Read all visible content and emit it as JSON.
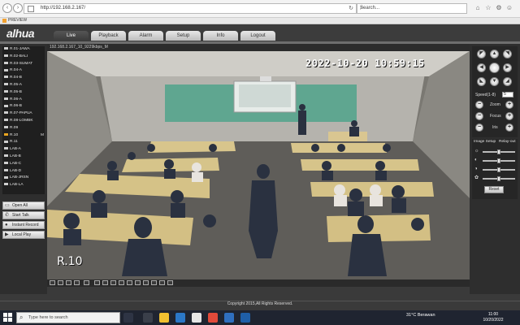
{
  "browser": {
    "url": "http://192.168.2.167/",
    "search_placeholder": "Search...",
    "tab_title": "PREVIEW"
  },
  "app": {
    "logo": "alhua",
    "menu": [
      {
        "label": "Live",
        "active": true
      },
      {
        "label": "Playback",
        "active": false
      },
      {
        "label": "Alarm",
        "active": false
      },
      {
        "label": "Setup",
        "active": false
      },
      {
        "label": "Info",
        "active": false
      },
      {
        "label": "Logout",
        "active": false
      }
    ]
  },
  "cameras": [
    {
      "label": "R.01-JAWA",
      "active": false
    },
    {
      "label": "R.02-BALI",
      "active": false
    },
    {
      "label": "R.03-SUMAT",
      "active": false
    },
    {
      "label": "R.04-A",
      "active": false
    },
    {
      "label": "R.04-B",
      "active": false
    },
    {
      "label": "R.05-A",
      "active": false
    },
    {
      "label": "R.05-B",
      "active": false
    },
    {
      "label": "R.06-A",
      "active": false
    },
    {
      "label": "R.06-B",
      "active": false
    },
    {
      "label": "R.07-PAPUA",
      "active": false
    },
    {
      "label": "R.08-LOMBK",
      "active": false
    },
    {
      "label": "R.09",
      "active": false
    },
    {
      "label": "R.10",
      "active": true,
      "mark": "M"
    },
    {
      "label": "R.11",
      "active": false
    },
    {
      "label": "LAB-A",
      "active": false
    },
    {
      "label": "LAB-B",
      "active": false
    },
    {
      "label": "LAB-C",
      "active": false
    },
    {
      "label": "LAB-D",
      "active": false
    },
    {
      "label": "LAB-JRSN",
      "active": false
    },
    {
      "label": "LAB-LA",
      "active": false
    }
  ],
  "side_buttons": {
    "open_all": "Open All",
    "start_talk": "Start Talk",
    "instant_record": "Instant Record",
    "local_play": "Local Play"
  },
  "video": {
    "info_bar": "192.168.2.167_10_9229kbps_M",
    "timestamp": "2022-10-20 10:59:15",
    "channel_name": "R.10"
  },
  "ptz": {
    "speed_label": "Speed(1-8)",
    "speed_value": "5",
    "zoom_label": "Zoom",
    "focus_label": "Focus",
    "iris_label": "Iris"
  },
  "image_setup": {
    "tab_setup": "Image Setup",
    "tab_relay": "Relay-out",
    "sliders": [
      {
        "name": "brightness",
        "value": 0.5
      },
      {
        "name": "contrast",
        "value": 0.5
      },
      {
        "name": "saturation",
        "value": 0.5
      },
      {
        "name": "hue",
        "value": 0.5
      }
    ],
    "reset_label": "Reset"
  },
  "footer": {
    "copyright": "Copyright 2015,All Rights Reserved."
  },
  "taskbar": {
    "search_placeholder": "Type here to search",
    "weather": "31°C  Berawan",
    "time": "11:00",
    "date": "10/20/2022"
  }
}
